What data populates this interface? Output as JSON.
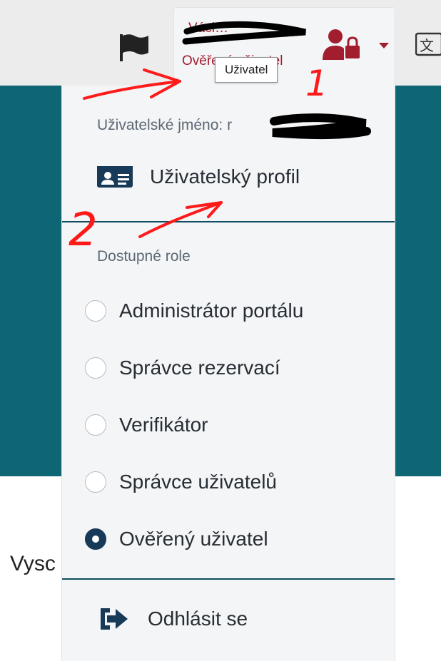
{
  "header": {
    "user_name": "Václ…",
    "user_role": "Ověřený uživatel",
    "tooltip": "Uživatel",
    "icons": {
      "flag": "flag-icon",
      "user_lock": "user-lock-icon",
      "caret": "caret-down-icon",
      "translate": "translate-icon"
    },
    "accent_color": "#a21d2d"
  },
  "user_menu": {
    "username_label": "Uživatelské jméno: r",
    "profile_label": "Uživatelský profil",
    "roles_heading": "Dostupné role",
    "roles": [
      {
        "label": "Administrátor portálu",
        "checked": false
      },
      {
        "label": "Správce rezervací",
        "checked": false
      },
      {
        "label": "Verifikátor",
        "checked": false
      },
      {
        "label": "Správce uživatelů",
        "checked": false
      },
      {
        "label": "Ověřený uživatel",
        "checked": true
      }
    ],
    "logout_label": "Odhlásit se"
  },
  "page": {
    "body_text": "Vysc",
    "band_color": "#0e6574"
  },
  "annotations": {
    "marker_1": "1",
    "marker_2": "2",
    "color": "#ff1a1a"
  }
}
